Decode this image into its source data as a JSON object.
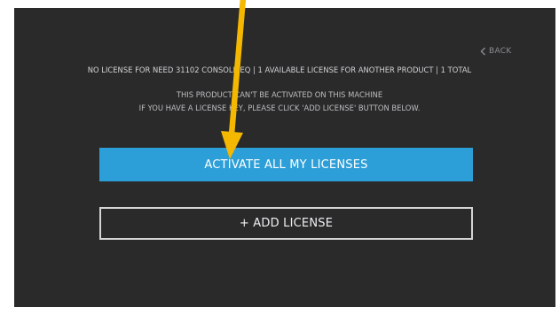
{
  "header": {
    "back_label": "BACK",
    "back_icon": "chevron-left-icon"
  },
  "license_info": {
    "summary": "NO LICENSE FOR NEED 31102 CONSOLE EQ | 1 AVAILABLE LICENSE FOR ANOTHER PRODUCT | 1 TOTAL",
    "message_line1": "THIS PRODUCT CAN'T BE ACTIVATED ON THIS MACHINE",
    "message_line2": "IF YOU HAVE A LICENSE KEY, PLEASE CLICK 'ADD LICENSE' BUTTON BELOW."
  },
  "actions": {
    "activate_label": "ACTIVATE ALL MY LICENSES",
    "add_license_label": "+ ADD LICENSE"
  },
  "colors": {
    "panel_background": "#2a2a2b",
    "accent_blue": "#2d9fd8",
    "annotation_arrow": "#f5b800"
  }
}
